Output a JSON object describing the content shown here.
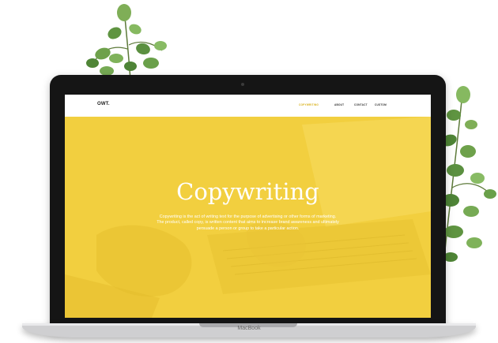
{
  "site": {
    "logo": "OWT.",
    "nav": [
      "COPYWRITING",
      "ABOUT",
      "CONTACT",
      "CUSTOM"
    ],
    "hero_title": "Copywriting",
    "hero_text_lines": [
      "Copywriting is the act of writing text for the purpose of advertising or other forms of marketing.",
      "The product, called copy, is written content that aims to increase brand awareness and ultimately",
      "persuade a person or group to take a particular action."
    ]
  },
  "device": {
    "brand": "MacBook"
  },
  "colors": {
    "hero": "#f2cf3f",
    "nav_active": "#d9b11b",
    "bezel": "#151515"
  }
}
